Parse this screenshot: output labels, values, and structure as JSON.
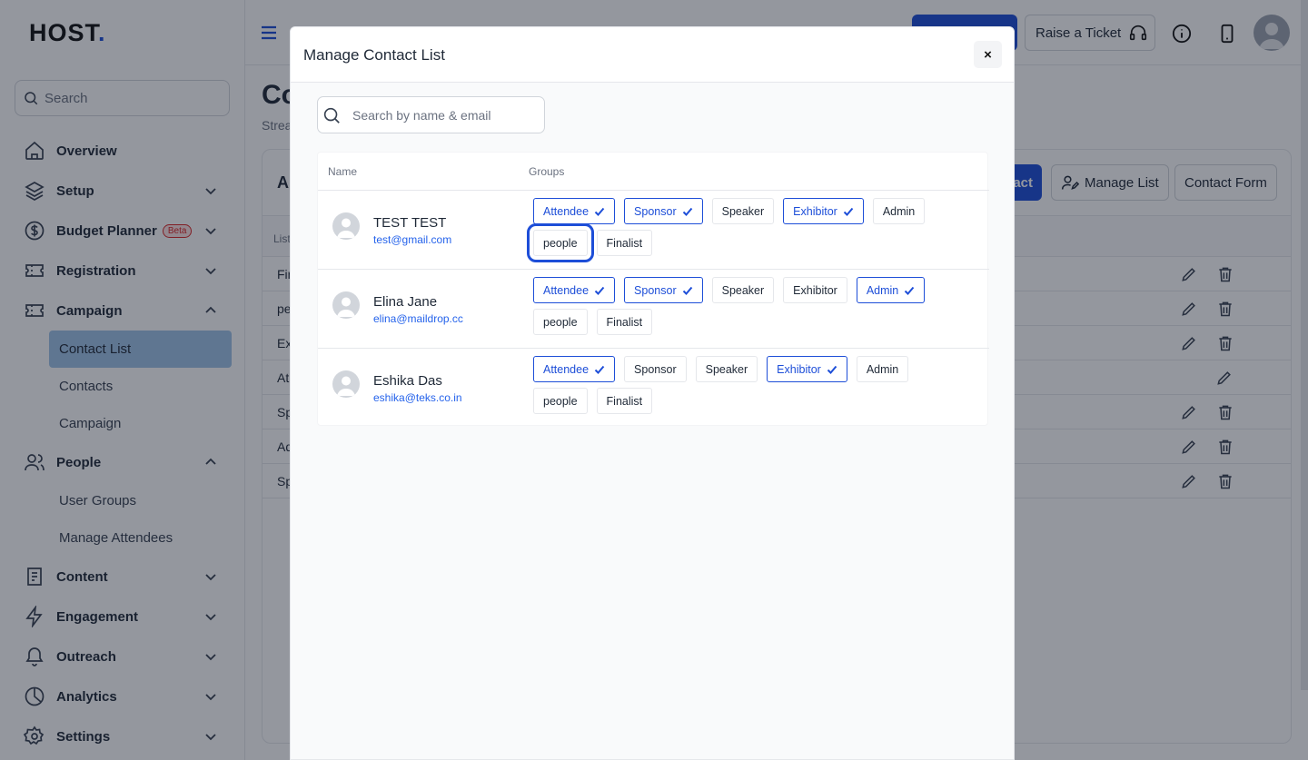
{
  "brand": {
    "logo_text_a": "H",
    "logo_text_o": "O",
    "logo_text_b": "ST",
    "logo_dot": "."
  },
  "sidebar": {
    "search_placeholder": "Search",
    "items": [
      {
        "label": "Overview",
        "icon": "home-icon"
      },
      {
        "label": "Setup",
        "icon": "layers-icon"
      },
      {
        "label": "Budget Planner",
        "badge": "Beta",
        "icon": "dollar-icon"
      },
      {
        "label": "Registration",
        "icon": "ticket-icon"
      },
      {
        "label": "Campaign",
        "icon": "ticket-icon"
      },
      {
        "label": "People",
        "icon": "users-icon"
      },
      {
        "label": "Content",
        "icon": "document-icon"
      },
      {
        "label": "Engagement",
        "icon": "bolt-icon"
      },
      {
        "label": "Outreach",
        "icon": "bell-icon"
      },
      {
        "label": "Analytics",
        "icon": "pie-chart-icon"
      },
      {
        "label": "Settings",
        "icon": "gear-icon"
      }
    ],
    "campaign_sub": [
      "Contact List",
      "Contacts",
      "Campaign"
    ],
    "people_sub": [
      "User Groups",
      "Manage Attendees"
    ]
  },
  "header": {
    "ticket_label": "Raise a Ticket"
  },
  "page": {
    "title": "Co",
    "subtitle": "Strea",
    "card_title": "A",
    "header_col": "List",
    "buttons": {
      "blue": "act",
      "manage": "Manage List",
      "form": "Contact Form"
    },
    "rows": [
      "Fir",
      "pe",
      "Ex",
      "At",
      "Sp",
      "Ad",
      "Sp"
    ]
  },
  "modal": {
    "title": "Manage Contact List",
    "close": "×",
    "search_placeholder": "Search by name & email",
    "col_name": "Name",
    "col_groups": "Groups",
    "contacts": [
      {
        "name": "TEST TEST",
        "email": "test@gmail.com",
        "groups": [
          {
            "label": "Attendee",
            "on": true
          },
          {
            "label": "Sponsor",
            "on": true
          },
          {
            "label": "Speaker",
            "on": false
          },
          {
            "label": "Exhibitor",
            "on": true
          },
          {
            "label": "Admin",
            "on": false
          },
          {
            "label": "people",
            "on": false,
            "focus": true
          },
          {
            "label": "Finalist",
            "on": false
          }
        ]
      },
      {
        "name": "Elina Jane",
        "email": "elina@maildrop.cc",
        "groups": [
          {
            "label": "Attendee",
            "on": true
          },
          {
            "label": "Sponsor",
            "on": true
          },
          {
            "label": "Speaker",
            "on": false
          },
          {
            "label": "Exhibitor",
            "on": false
          },
          {
            "label": "Admin",
            "on": true
          },
          {
            "label": "people",
            "on": false
          },
          {
            "label": "Finalist",
            "on": false
          }
        ]
      },
      {
        "name": "Eshika Das",
        "email": "eshika@teks.co.in",
        "groups": [
          {
            "label": "Attendee",
            "on": true
          },
          {
            "label": "Sponsor",
            "on": false
          },
          {
            "label": "Speaker",
            "on": false
          },
          {
            "label": "Exhibitor",
            "on": true
          },
          {
            "label": "Admin",
            "on": false
          },
          {
            "label": "people",
            "on": false
          },
          {
            "label": "Finalist",
            "on": false
          }
        ]
      }
    ]
  },
  "colors": {
    "accent": "#1d4ed8",
    "active_nav": "#9fc3e7",
    "overlay": "rgba(17,24,39,0.45)"
  }
}
